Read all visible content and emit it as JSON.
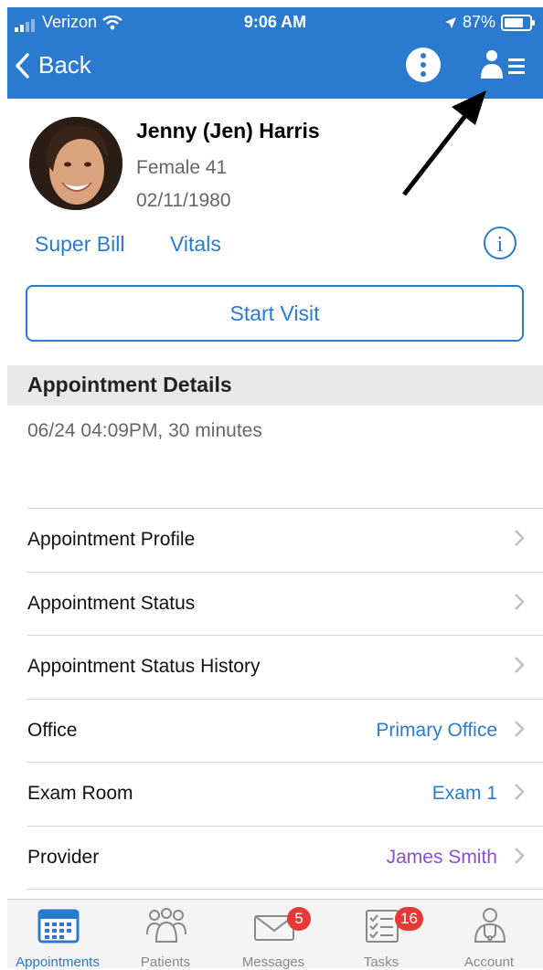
{
  "status_bar": {
    "carrier": "Verizon",
    "time": "9:06 AM",
    "battery": "87%"
  },
  "nav": {
    "back_label": "Back"
  },
  "patient": {
    "name": "Jenny (Jen) Harris",
    "gender_age": "Female 41",
    "dob": "02/11/1980"
  },
  "links": {
    "super_bill": "Super Bill",
    "vitals": "Vitals"
  },
  "start_visit_label": "Start Visit",
  "appointment": {
    "section_title": "Appointment Details",
    "time_text": "06/24 04:09PM, 30 minutes",
    "rows": [
      {
        "label": "Appointment Profile",
        "value": ""
      },
      {
        "label": "Appointment Status",
        "value": ""
      },
      {
        "label": "Appointment Status History",
        "value": ""
      },
      {
        "label": "Office",
        "value": "Primary Office"
      },
      {
        "label": "Exam Room",
        "value": "Exam 1"
      },
      {
        "label": "Provider",
        "value": "James Smith"
      }
    ]
  },
  "tabs": [
    {
      "label": "Appointments",
      "badge": ""
    },
    {
      "label": "Patients",
      "badge": ""
    },
    {
      "label": "Messages",
      "badge": "5"
    },
    {
      "label": "Tasks",
      "badge": "16"
    },
    {
      "label": "Account",
      "badge": ""
    }
  ],
  "colors": {
    "brand": "#2a7ad0",
    "provider": "#8a4fd8",
    "badge": "#e53935"
  }
}
